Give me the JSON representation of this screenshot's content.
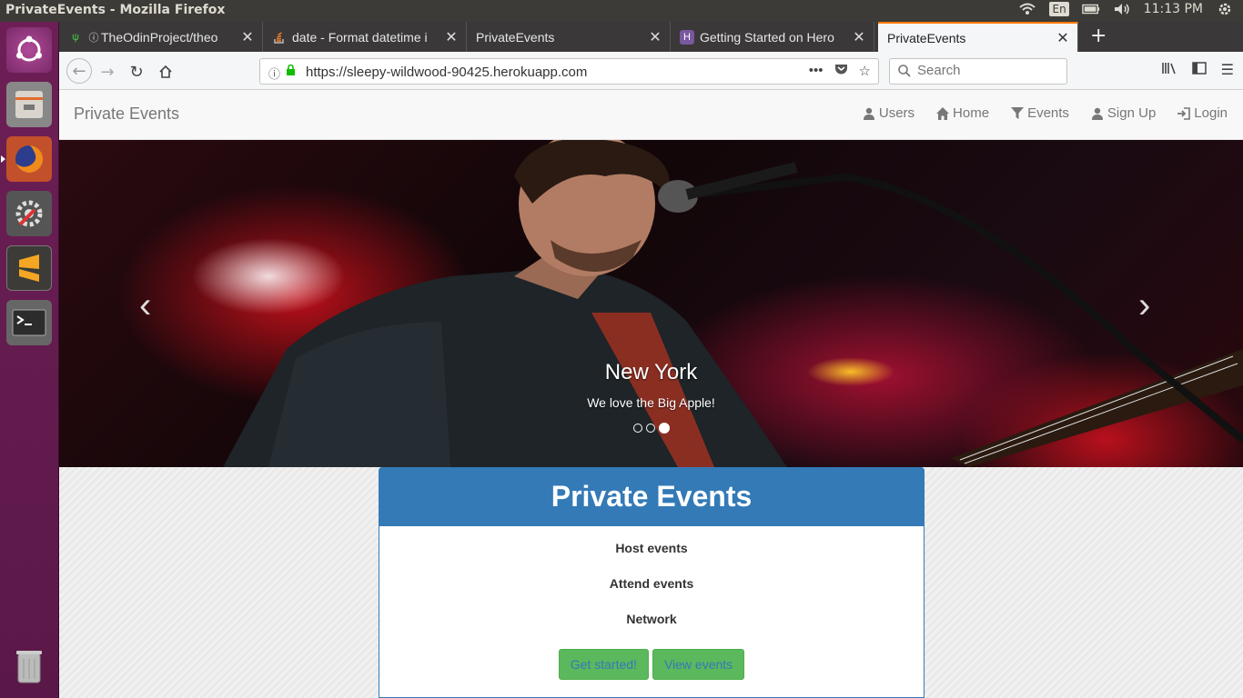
{
  "system": {
    "window_title": "PrivateEvents - Mozilla Firefox",
    "keyboard": "En",
    "clock": "11:13 PM"
  },
  "launcher": {
    "items": [
      "ubuntu-dash-icon",
      "files-icon",
      "firefox-icon",
      "settings-icon",
      "sublime-text-icon",
      "terminal-icon",
      "trash-icon"
    ]
  },
  "browser": {
    "tabs": [
      {
        "label": "TheOdinProject/theo"
      },
      {
        "label": "date - Format datetime i"
      },
      {
        "label": "PrivateEvents"
      },
      {
        "label": "Getting Started on Hero"
      },
      {
        "label": "PrivateEvents"
      }
    ],
    "url": "https://sleepy-wildwood-90425.herokuapp.com",
    "search_placeholder": "Search",
    "accent": "#ff7a00"
  },
  "site": {
    "brand": "Private Events",
    "nav": [
      {
        "label": "Users",
        "icon": "user-icon"
      },
      {
        "label": "Home",
        "icon": "home-icon"
      },
      {
        "label": "Events",
        "icon": "filter-icon"
      },
      {
        "label": "Sign Up",
        "icon": "user-icon"
      },
      {
        "label": "Login",
        "icon": "login-icon"
      }
    ],
    "carousel": {
      "caption_title": "New York",
      "caption_text": "We love the Big Apple!",
      "slide_count": 3,
      "active_slide": 3
    },
    "panel": {
      "title": "Private Events",
      "features": [
        "Host events",
        "Attend events",
        "Network"
      ],
      "buttons": [
        "Get started!",
        "View events"
      ]
    },
    "colors": {
      "primary": "#337ab7",
      "success": "#5cb85c"
    }
  }
}
